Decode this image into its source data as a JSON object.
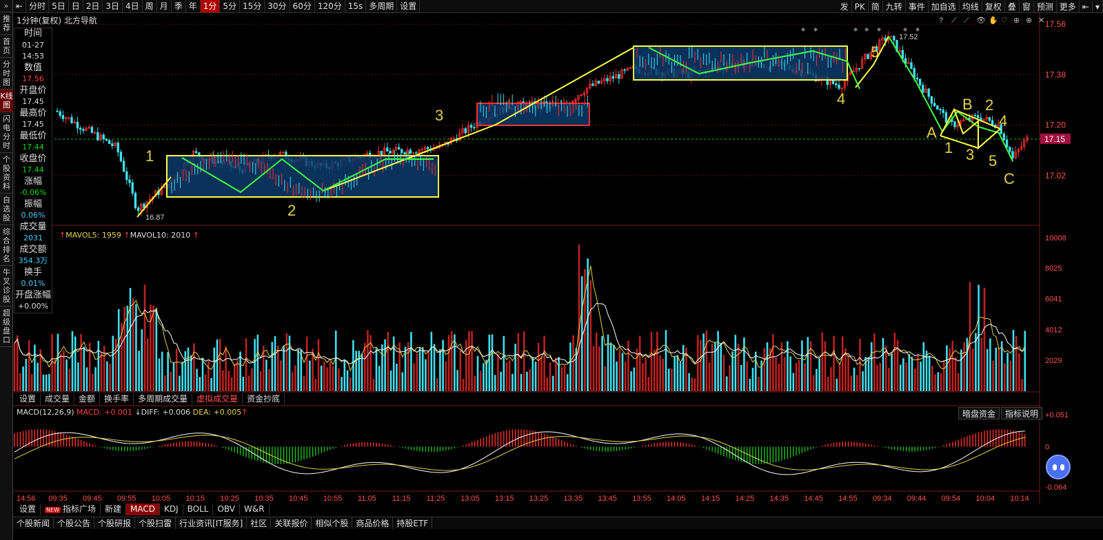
{
  "toolbar": {
    "left": [
      "分时",
      "5日",
      "日",
      "2日",
      "3日",
      "4日",
      "周",
      "月",
      "季",
      "年",
      "1分",
      "5分",
      "15分",
      "30分",
      "60分",
      "120分",
      "15s",
      "多周期",
      "设置"
    ],
    "active": "1分",
    "right": [
      "发",
      "PK",
      "简",
      "九转",
      "事件",
      "加自选",
      "均线",
      "复权",
      "叠",
      "窗",
      "预测",
      "更多"
    ]
  },
  "left_tabs": [
    "推荐",
    "首页",
    "分时图",
    "K线图",
    "闪电分时",
    "个股资料",
    "自选股",
    "综合排名",
    "牛叉诊股",
    "超级盘口"
  ],
  "left_active": "K线图",
  "chart_title": "1分钟(复权) 北方导航",
  "info": [
    {
      "label": "时间",
      "value": "01-27",
      "value2": "14:53",
      "color": "#dddddd"
    },
    {
      "label": "数值",
      "value": "17.56",
      "color": "#ff4040"
    },
    {
      "label": "开盘价",
      "value": "17.45",
      "color": "#dddddd"
    },
    {
      "label": "最高价",
      "value": "17.45",
      "color": "#dddddd"
    },
    {
      "label": "最低价",
      "value": "17.44",
      "color": "#00e000"
    },
    {
      "label": "收盘价",
      "value": "17.44",
      "color": "#00e000"
    },
    {
      "label": "涨幅",
      "value": "-0.06%",
      "color": "#00e000"
    },
    {
      "label": "振幅",
      "value": "0.06%",
      "color": "#40d0ff"
    },
    {
      "label": "成交量",
      "value": "2031",
      "color": "#40d0ff"
    },
    {
      "label": "成交额",
      "value": "354.3万",
      "color": "#40d0ff"
    },
    {
      "label": "换手",
      "value": "0.01%",
      "color": "#40d0ff"
    },
    {
      "label": "开盘涨幅",
      "value": "+0.00%",
      "color": "#dddddd"
    }
  ],
  "price_axis": [
    "17.56",
    "17.38",
    "17.20",
    "17.15",
    "17.02"
  ],
  "current_price": "17.15",
  "low_label": "16.87",
  "high_label": "17.52",
  "wave_labels": [
    {
      "t": "1",
      "c": "#e6d14a"
    },
    {
      "t": "2",
      "c": "#e6d14a"
    },
    {
      "t": "3",
      "c": "#e6d14a"
    },
    {
      "t": "4",
      "c": "#e6d14a"
    },
    {
      "t": "5",
      "c": "#e6d14a"
    },
    {
      "t": "A",
      "c": "#e6d14a"
    },
    {
      "t": "B",
      "c": "#e6d14a"
    },
    {
      "t": "C",
      "c": "#e6d14a"
    },
    {
      "t": "1",
      "c": "#e6d14a"
    },
    {
      "t": "2",
      "c": "#e6d14a"
    },
    {
      "t": "3",
      "c": "#e6d14a"
    },
    {
      "t": "4",
      "c": "#e6d14a"
    },
    {
      "t": "5",
      "c": "#e6d14a"
    }
  ],
  "volume": {
    "label": "MAVOL5: 1959",
    "label2": "MAVOL10: 2010",
    "axis": [
      "10008",
      "8025",
      "6041",
      "4012",
      "2029"
    ]
  },
  "volume_tabs": [
    "设置",
    "成交量",
    "金额",
    "换手率",
    "多周期成交量",
    "虚拟成交量",
    "资金抄底"
  ],
  "volume_active": "虚拟成交量",
  "macd": {
    "label": "MACD(12,26,9)",
    "macd": "MACD: +0.001",
    "diff": "DIFF: +0.006",
    "dea": "DEA: +0.005",
    "axis": [
      "+0.051",
      "0",
      "-0.064"
    ],
    "btn1": "暗盘资金",
    "btn2": "指标说明"
  },
  "time_axis": [
    "14:56",
    "09:35",
    "09:45",
    "09:55",
    "10:05",
    "10:15",
    "10:25",
    "10:35",
    "10:45",
    "10:55",
    "11:05",
    "11:15",
    "11:25",
    "13:05",
    "13:15",
    "13:25",
    "13:35",
    "13:45",
    "13:55",
    "14:05",
    "14:15",
    "14:25",
    "14:35",
    "14:45",
    "14:55",
    "09:34",
    "09:44",
    "09:54",
    "10:04",
    "10:14"
  ],
  "indicator_tabs": [
    "设置",
    "指标广场",
    "新建",
    "MACD",
    "KDJ",
    "BOLL",
    "OBV",
    "W&R"
  ],
  "indicator_active": "MACD",
  "new_badge": "NEW",
  "bottom_tabs": [
    "个股新闻",
    "个股公告",
    "个股研报",
    "个股扫雷",
    "行业资讯[IT服务]",
    "社区",
    "关联报价",
    "相似个股",
    "商品价格",
    "持股ETF"
  ],
  "chart_data": {
    "type": "candlestick",
    "series": [
      {
        "name": "MAVOL5",
        "values": []
      },
      {
        "name": "MAVOL10",
        "values": []
      }
    ],
    "ylim": [
      16.85,
      17.58
    ],
    "current": 17.15,
    "low": 16.87,
    "high": 17.52
  }
}
